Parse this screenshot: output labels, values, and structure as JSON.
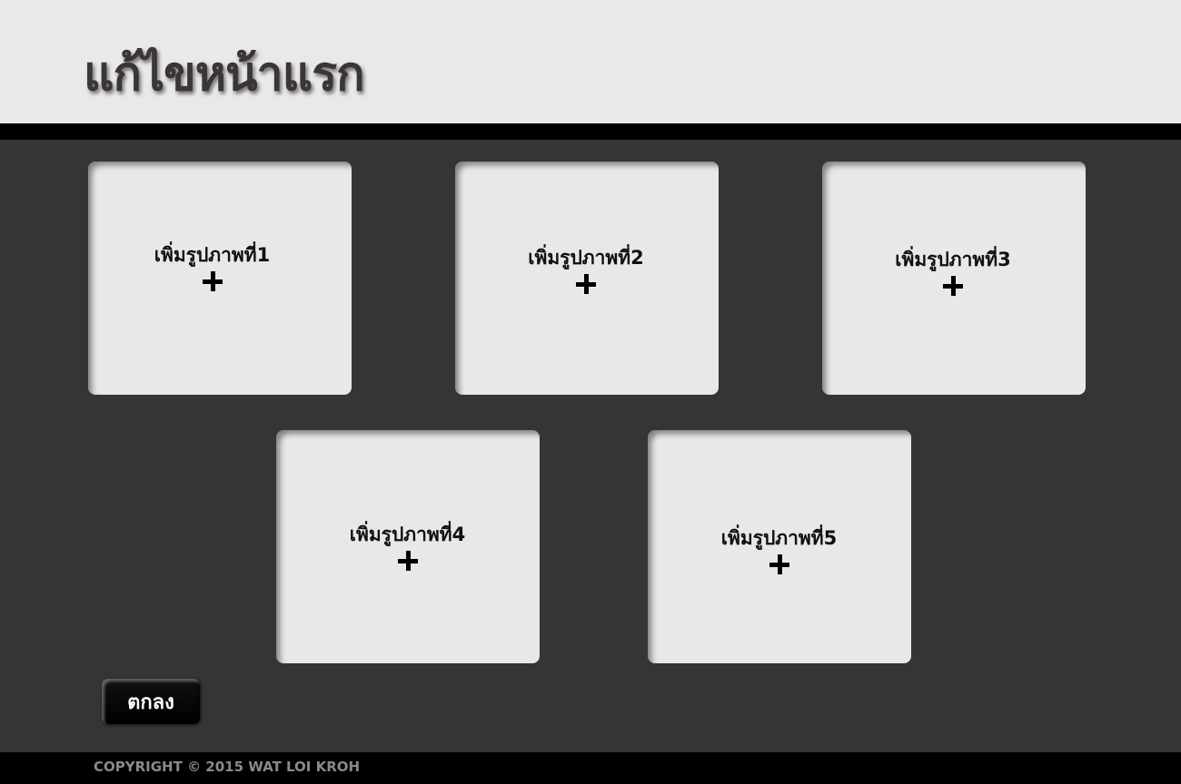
{
  "header": {
    "title": "แก้ไขหน้าแรก"
  },
  "cards": [
    {
      "label": "เพิ่มรูปภาพที่1",
      "icon": "plus-icon"
    },
    {
      "label": "เพิ่มรูปภาพที่2",
      "icon": "plus-icon"
    },
    {
      "label": "เพิ่มรูปภาพที่3",
      "icon": "plus-icon"
    },
    {
      "label": "เพิ่มรูปภาพที่4",
      "icon": "plus-icon"
    },
    {
      "label": "เพิ่มรูปภาพที่5",
      "icon": "plus-icon"
    }
  ],
  "actions": {
    "ok_label": "ตกลง"
  },
  "footer": {
    "copyright": "COPYRIGHT © 2015 WAT LOI KROH"
  },
  "colors": {
    "header_bg": "#e9e9e9",
    "main_bg": "#353535",
    "card_bg": "#e8e8e8",
    "bar": "#000000",
    "footer_text": "#8a8a8a"
  }
}
